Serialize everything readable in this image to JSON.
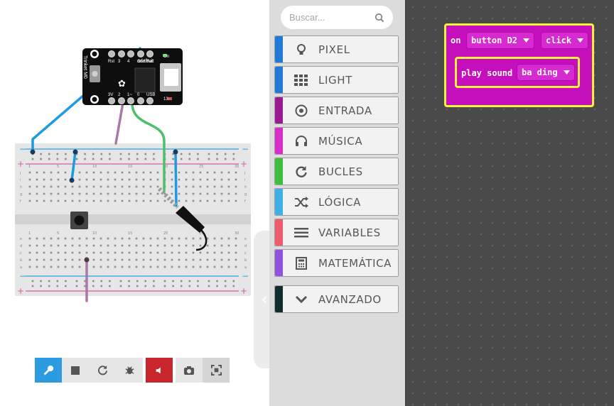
{
  "toolbox": {
    "search": {
      "placeholder": "Buscar..."
    },
    "categories": [
      {
        "label": "PIXEL",
        "color": "#1e7ad6",
        "icon": "lightbulb-icon"
      },
      {
        "label": "LIGHT",
        "color": "#1e7ad6",
        "icon": "grid-icon"
      },
      {
        "label": "ENTRADA",
        "color": "#9b1a8f",
        "icon": "target-icon"
      },
      {
        "label": "MÚSICA",
        "color": "#d92dc9",
        "icon": "headphones-icon"
      },
      {
        "label": "BUCLES",
        "color": "#3cbf3c",
        "icon": "refresh-icon"
      },
      {
        "label": "LÓGICA",
        "color": "#3fb0e6",
        "icon": "shuffle-icon"
      },
      {
        "label": "VARIABLES",
        "color": "#ee5b6c",
        "icon": "list-icon"
      },
      {
        "label": "MATEMÁTICA",
        "color": "#8e54e0",
        "icon": "calculator-icon"
      },
      {
        "label": "AVANZADO",
        "color": "#0e2e2e",
        "icon": "chevron-down-icon"
      }
    ]
  },
  "workspace": {
    "event_block": {
      "keyword": "on",
      "button": "button D2",
      "action": "click"
    },
    "sound_block": {
      "keyword": "play sound",
      "sound": "ba ding"
    },
    "colors": {
      "block": "#c50fbd",
      "outline": "#fff23b"
    }
  },
  "simulator": {
    "board": {
      "brand": "adafruit",
      "model": "Trinket M0",
      "pin_labels_top": [
        "Rst",
        "3",
        "4",
        "Gnd",
        "Bat"
      ],
      "pin_labels_bottom": [
        "3V",
        "2",
        "1~",
        "0",
        "USB"
      ],
      "on_label": "On",
      "pin13_label": "13"
    },
    "breadboard": {
      "col_numbers": [
        "1",
        "5",
        "10",
        "15",
        "20",
        "25",
        "30"
      ],
      "row_letters_top": [
        "j",
        "i",
        "h",
        "g",
        "f"
      ],
      "row_letters_bottom": [
        "e",
        "d",
        "c",
        "b",
        "a"
      ]
    },
    "toolbar": [
      "wrench-icon",
      "stop-icon",
      "restart-icon",
      "debug-icon",
      "mute-icon",
      "camera-icon",
      "fullscreen-icon"
    ]
  }
}
